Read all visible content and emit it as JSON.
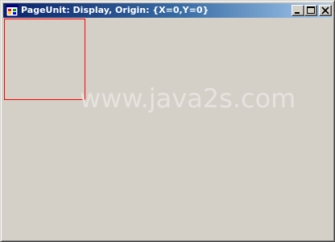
{
  "window": {
    "title": "PageUnit: Display, Origin: {X=0,Y=0}",
    "app_icon": "windows-form-icon",
    "caption_buttons": {
      "minimize_icon": "minimize-icon",
      "maximize_icon": "maximize-icon",
      "close_icon": "close-icon"
    }
  },
  "canvas": {
    "rectangle_color": "#ff0000",
    "watermark": "www.java2s.com"
  },
  "colors": {
    "titlebar_start": "#0a246a",
    "titlebar_end": "#a6caf0",
    "window_background": "#d4d0c8"
  }
}
